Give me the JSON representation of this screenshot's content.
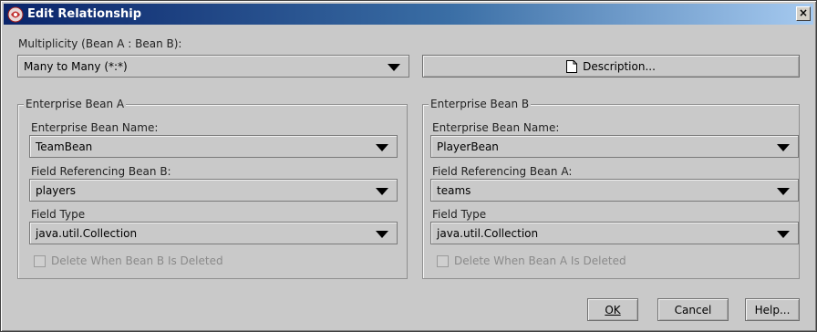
{
  "window": {
    "title": "Edit Relationship",
    "close_glyph": "×"
  },
  "multiplicity": {
    "label": "Multiplicity (Bean A : Bean B):",
    "value": "Many to Many (*:*)"
  },
  "description_button": {
    "label": "Description...",
    "icon": "document-icon"
  },
  "bean_a": {
    "group_title": "Enterprise Bean A",
    "name_label": "Enterprise Bean Name:",
    "name_value": "TeamBean",
    "field_label": "Field Referencing Bean B:",
    "field_value": "players",
    "type_label": "Field Type",
    "type_value": "java.util.Collection",
    "delete_label": "Delete When Bean B Is Deleted",
    "delete_checked": false
  },
  "bean_b": {
    "group_title": "Enterprise Bean B",
    "name_label": "Enterprise Bean Name:",
    "name_value": "PlayerBean",
    "field_label": "Field Referencing Bean A:",
    "field_value": "teams",
    "type_label": "Field Type",
    "type_value": "java.util.Collection",
    "delete_label": "Delete When Bean A Is Deleted",
    "delete_checked": false
  },
  "buttons": {
    "ok": "OK",
    "cancel": "Cancel",
    "help": "Help..."
  },
  "colors": {
    "titlebar_start": "#0a246a",
    "titlebar_end": "#a6caf0",
    "dialog_bg": "#c9c9c9"
  }
}
